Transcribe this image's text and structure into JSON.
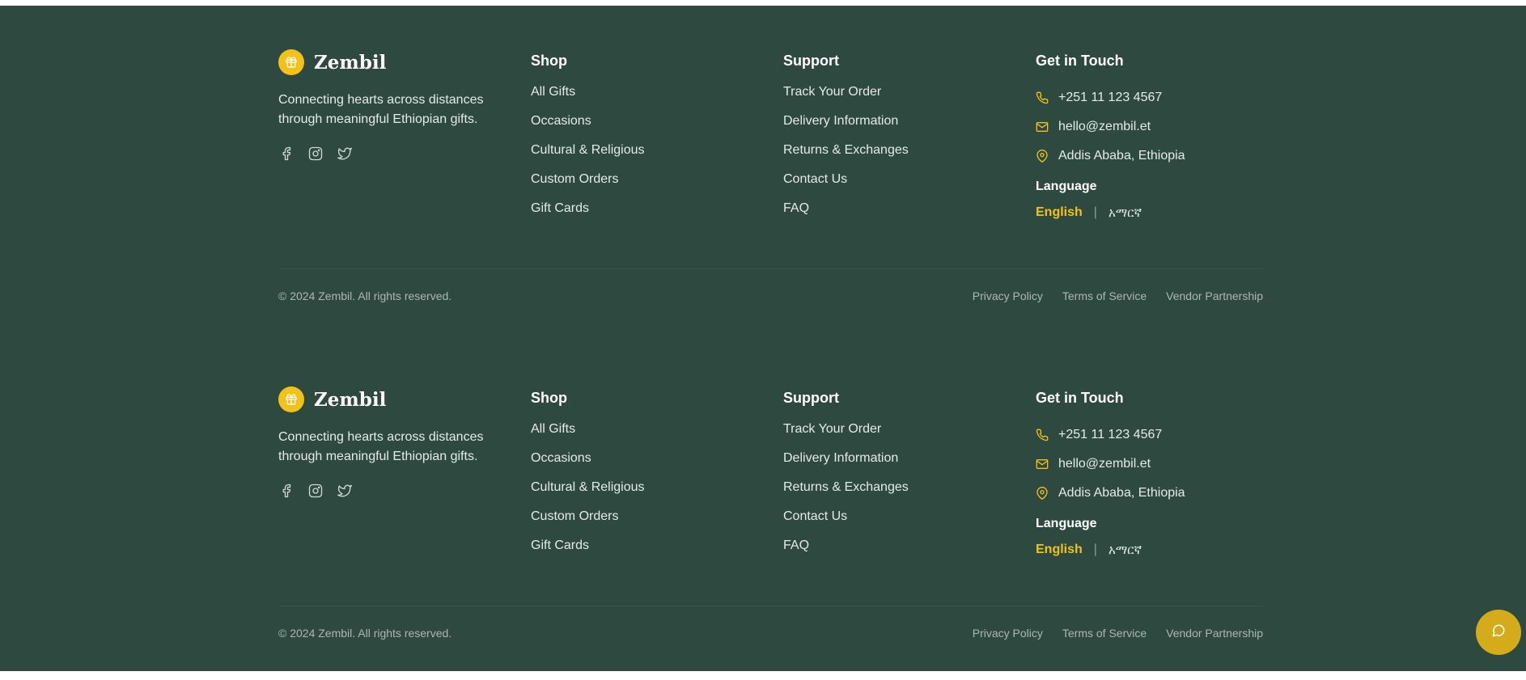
{
  "brand": {
    "name": "Zembil",
    "tagline": "Connecting hearts across distances through meaningful Ethiopian gifts.",
    "logo_icon": "gift-icon",
    "accent_color": "#f2c21a",
    "background_color": "#2e4a40",
    "social": [
      "facebook-icon",
      "instagram-icon",
      "twitter-icon"
    ]
  },
  "shop": {
    "title": "Shop",
    "links": [
      "All Gifts",
      "Occasions",
      "Cultural & Religious",
      "Custom Orders",
      "Gift Cards"
    ]
  },
  "support": {
    "title": "Support",
    "links": [
      "Track Your Order",
      "Delivery Information",
      "Returns & Exchanges",
      "Contact Us",
      "FAQ"
    ]
  },
  "contact": {
    "title": "Get in Touch",
    "phone": "+251 11 123 4567",
    "email": "hello@zembil.et",
    "address": "Addis Ababa, Ethiopia",
    "language_title": "Language",
    "language_en": "English",
    "language_separator": "|",
    "language_am": "አማርኛ"
  },
  "bottom": {
    "copyright": "© 2024 Zembil. All rights reserved.",
    "privacy": "Privacy Policy",
    "terms": "Terms of Service",
    "vendor": "Vendor Partnership"
  },
  "chat_button": {
    "icon": "chat-bubble-icon"
  }
}
